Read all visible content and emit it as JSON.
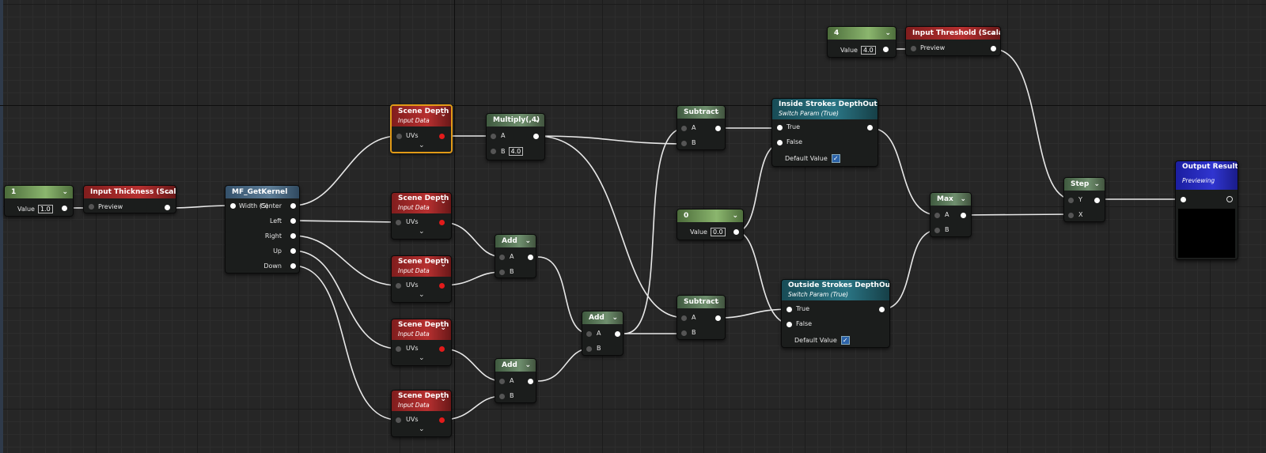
{
  "nodes": {
    "const1": {
      "title": "1",
      "value_label": "Value",
      "value": "1.0"
    },
    "thickness": {
      "title": "Input Thickness (Scalar)",
      "pin": "Preview"
    },
    "kernel": {
      "title": "MF_GetKernel",
      "in": "Width (S)",
      "outs": [
        "Center",
        "Left",
        "Right",
        "Up",
        "Down"
      ]
    },
    "sd1": {
      "title": "Scene Depth",
      "subtitle": "Input Data",
      "pin": "UVs"
    },
    "sd2": {
      "title": "Scene Depth",
      "subtitle": "Input Data",
      "pin": "UVs"
    },
    "sd3": {
      "title": "Scene Depth",
      "subtitle": "Input Data",
      "pin": "UVs"
    },
    "sd4": {
      "title": "Scene Depth",
      "subtitle": "Input Data",
      "pin": "UVs"
    },
    "sd5": {
      "title": "Scene Depth",
      "subtitle": "Input Data",
      "pin": "UVs"
    },
    "multiply": {
      "title": "Multiply(,4)",
      "a": "A",
      "b": "B",
      "b_value": "4.0"
    },
    "add1": {
      "title": "Add",
      "a": "A",
      "b": "B"
    },
    "add2": {
      "title": "Add",
      "a": "A",
      "b": "B"
    },
    "add3": {
      "title": "Add",
      "a": "A",
      "b": "B"
    },
    "sub1": {
      "title": "Subtract",
      "a": "A",
      "b": "B"
    },
    "sub2": {
      "title": "Subtract",
      "a": "A",
      "b": "B"
    },
    "const0": {
      "title": "0",
      "value_label": "Value",
      "value": "0.0"
    },
    "inside": {
      "title": "Inside Strokes DepthOutline",
      "subtitle": "Switch Param (True)",
      "true": "True",
      "false": "False",
      "default": "Default Value"
    },
    "outside": {
      "title": "Outside Strokes DepthOutline",
      "subtitle": "Switch Param (True)",
      "true": "True",
      "false": "False",
      "default": "Default Value"
    },
    "max": {
      "title": "Max",
      "a": "A",
      "b": "B"
    },
    "const4": {
      "title": "4",
      "value_label": "Value",
      "value": "4.0"
    },
    "threshold": {
      "title": "Input Threshold (Scalar)",
      "pin": "Preview"
    },
    "step": {
      "title": "Step",
      "y": "Y",
      "x": "X"
    },
    "output": {
      "title": "Output Result",
      "subtitle": "Previewing"
    }
  },
  "glyphs": {
    "chevron": "⌄",
    "check": "✓"
  }
}
